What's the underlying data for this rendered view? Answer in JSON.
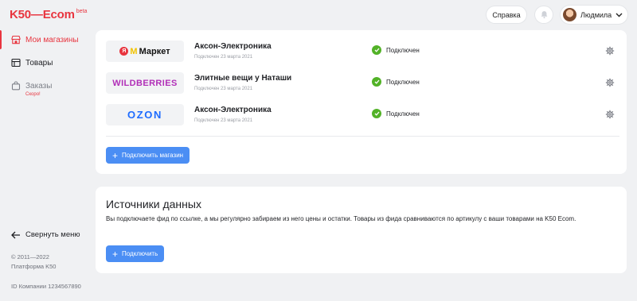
{
  "logo": {
    "text": "K50—Ecom",
    "beta": "beta"
  },
  "topbar": {
    "help_label": "Справка",
    "user_name": "Людмила"
  },
  "sidebar": {
    "items": [
      {
        "label": "Мои магазины",
        "icon": "store-icon",
        "active": true
      },
      {
        "label": "Товары",
        "icon": "list-icon",
        "active": false
      },
      {
        "label": "Заказы",
        "icon": "bag-icon",
        "active": false,
        "badge": "Скоро!"
      }
    ],
    "collapse_label": "Свернуть меню",
    "copyright": "© 2011—2022",
    "platform": "Платформа K50",
    "company_id": "ID Компании 1234567890"
  },
  "stores": [
    {
      "marketplace": "Маркет",
      "name": "Аксон-Электроника",
      "date": "Подключен 23 марта 2021",
      "status": "Подключен"
    },
    {
      "marketplace": "WILDBERRIES",
      "name": "Элитные вещи у Наташи",
      "date": "Подключен 23 марта 2021",
      "status": "Подключен"
    },
    {
      "marketplace": "OZON",
      "name": "Аксон-Электроника",
      "date": "Подключен 23 марта 2021",
      "status": "Подключен"
    }
  ],
  "connect_store_label": "Подключить магазин",
  "sources": {
    "title": "Источники данных",
    "description": "Вы подключаете фид по ссылке, а мы регулярно забираем из него цены и остатки. Товары из фида сравниваются по артикулу с ваши товарами на K50 Ecom.",
    "connect_label": "Подключить"
  },
  "colors": {
    "accent": "#e8353f",
    "primary": "#4b8ef4",
    "success": "#52b227"
  }
}
